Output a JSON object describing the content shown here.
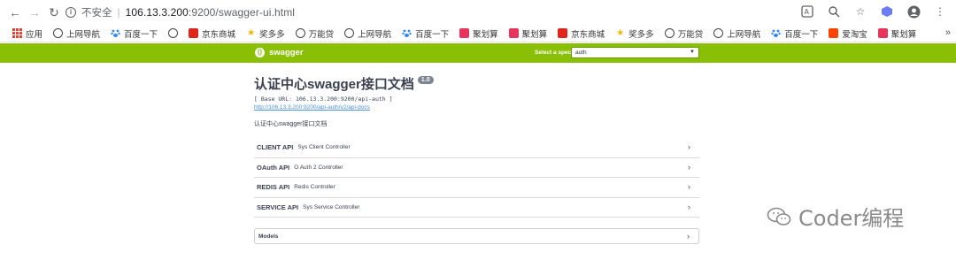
{
  "browser": {
    "insecure_label": "不安全",
    "separator": "|",
    "url_host": "106.13.3.200",
    "url_rest": ":9200/swagger-ui.html"
  },
  "bookmarks": [
    {
      "label": "应用",
      "icon": "apps-grid-icon",
      "color": "#e94235"
    },
    {
      "label": "上网导航",
      "icon": "globe-icon",
      "color": "#444444"
    },
    {
      "label": "百度一下",
      "icon": "baidu-paw-icon",
      "color": "#3385ff"
    },
    {
      "label": "",
      "icon": "globe-icon",
      "color": "#444444"
    },
    {
      "label": "京东商城",
      "icon": "jd-icon",
      "color": "#e1251b"
    },
    {
      "label": "奖多多",
      "icon": "star-icon",
      "color": "#f5b400"
    },
    {
      "label": "万能贷",
      "icon": "globe-icon",
      "color": "#444444"
    },
    {
      "label": "上网导航",
      "icon": "globe-icon",
      "color": "#444444"
    },
    {
      "label": "百度一下",
      "icon": "baidu-paw-icon",
      "color": "#3385ff"
    },
    {
      "label": "聚划算",
      "icon": "juhuasuan-icon",
      "color": "#e8335b"
    },
    {
      "label": "聚划算",
      "icon": "juhuasuan-icon",
      "color": "#e8335b"
    },
    {
      "label": "京东商城",
      "icon": "jd-icon",
      "color": "#e1251b"
    },
    {
      "label": "奖多多",
      "icon": "star-icon",
      "color": "#f5b400"
    },
    {
      "label": "万能贷",
      "icon": "globe-icon",
      "color": "#444444"
    },
    {
      "label": "上网导航",
      "icon": "globe-icon",
      "color": "#444444"
    },
    {
      "label": "百度一下",
      "icon": "baidu-paw-icon",
      "color": "#3385ff"
    },
    {
      "label": "爱淘宝",
      "icon": "taobao-icon",
      "color": "#ff4400"
    },
    {
      "label": "聚划算",
      "icon": "juhuasuan-icon",
      "color": "#e8335b"
    }
  ],
  "bookmarks_more": "»",
  "swagger": {
    "logo_text": "swagger",
    "spec_label": "Select a spec",
    "spec_value": "auth",
    "accent": "#89bf04",
    "title": "认证中心swagger接口文档",
    "version": "1.0",
    "base_url": "[ Base URL: 106.13.3.200:9200/api-auth ]",
    "docs_link": "http://106.13.3.200:9200/api-auth/v2/api-docs",
    "description": "认证中心swagger接口文档",
    "apis": [
      {
        "name": "CLIENT API",
        "desc": "Sys Client Controller"
      },
      {
        "name": "OAuth API",
        "desc": "O Auth 2 Controller"
      },
      {
        "name": "REDIS API",
        "desc": "Redis Controller"
      },
      {
        "name": "SERVICE API",
        "desc": "Sys Service Controller"
      }
    ],
    "models_label": "Models"
  },
  "watermark": "Coder编程"
}
